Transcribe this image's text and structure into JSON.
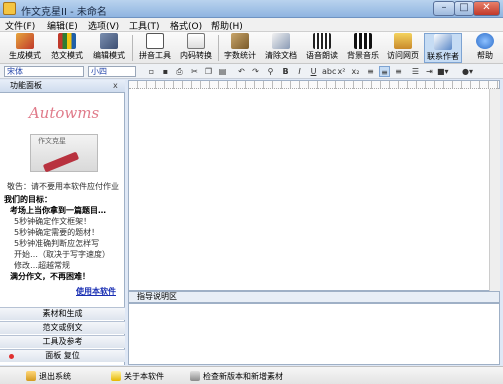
{
  "window": {
    "title": "作文克星II - 未命名"
  },
  "menu": [
    "文件(F)",
    "编辑(E)",
    "选项(V)",
    "工具(T)",
    "格式(O)",
    "帮助(H)"
  ],
  "toolbar": [
    {
      "label": "生成模式",
      "icon": "pencil-icon"
    },
    {
      "label": "范文模式",
      "icon": "books-icon"
    },
    {
      "label": "编辑模式",
      "icon": "edit-icon"
    },
    {
      "label": "拼音工具",
      "icon": "pinyin-icon"
    },
    {
      "label": "内码转换",
      "icon": "convert-icon"
    },
    {
      "label": "字数统计",
      "icon": "count-icon"
    },
    {
      "label": "清除文档",
      "icon": "eraser-icon"
    },
    {
      "label": "语音朗读",
      "icon": "speaker-icon"
    },
    {
      "label": "背景音乐",
      "icon": "piano-icon"
    },
    {
      "label": "访问网页",
      "icon": "home-icon"
    },
    {
      "label": "联系作者",
      "icon": "contact-icon"
    },
    {
      "label": "帮助",
      "icon": "help-icon"
    }
  ],
  "format": {
    "font_name": "宋体",
    "font_size": "小四"
  },
  "left_panel": {
    "title": "功能面板",
    "close": "x",
    "logo_text": "Autowms",
    "logo_book_title": "作文克星",
    "ad_line": "敬告：请不要用本软件应付作业",
    "goal_title": "我们的目标：",
    "goal_sub": "考场上当你拿到一篇题目…",
    "goal_items": [
      "5秒钟确定作文框架！",
      "5秒钟确定需要的题材！",
      "5秒钟准确判断应怎样写",
      "开始…（取决于写字速度）",
      "修改…超越常规"
    ],
    "goal_end": "满分作文，不再困难！",
    "use_link": "使用本软件",
    "sections": [
      "素材和生成",
      "范文或例文",
      "工具及参考",
      "面板    复位"
    ]
  },
  "guide": {
    "title": "指导说明区"
  },
  "status": [
    "退出系统",
    "关于本软件",
    "检查新版本和新增素材"
  ],
  "colors": {
    "accent": "#7da3d2",
    "link": "#1a2fb3",
    "logo": "#e07b8a"
  }
}
